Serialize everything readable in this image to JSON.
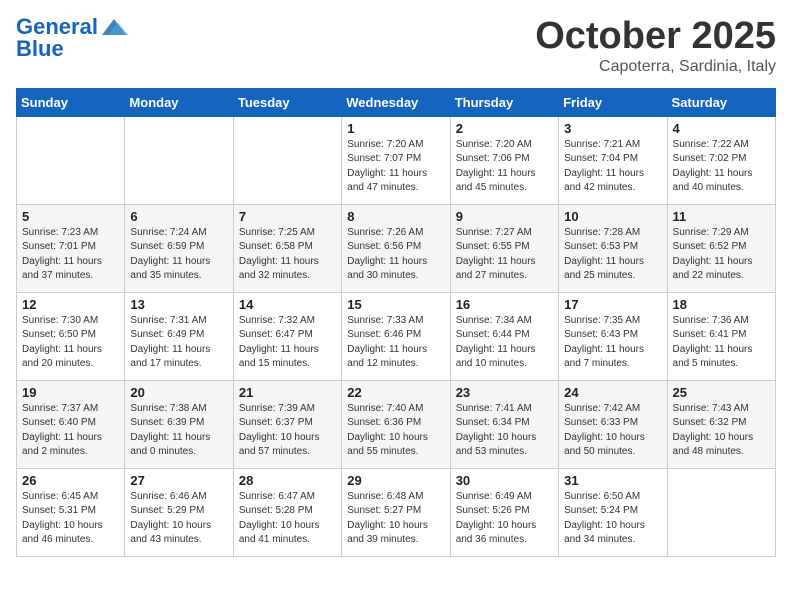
{
  "header": {
    "logo_general": "General",
    "logo_blue": "Blue",
    "month": "October 2025",
    "location": "Capoterra, Sardinia, Italy"
  },
  "days_of_week": [
    "Sunday",
    "Monday",
    "Tuesday",
    "Wednesday",
    "Thursday",
    "Friday",
    "Saturday"
  ],
  "weeks": [
    [
      {
        "day": "",
        "info": ""
      },
      {
        "day": "",
        "info": ""
      },
      {
        "day": "",
        "info": ""
      },
      {
        "day": "1",
        "info": "Sunrise: 7:20 AM\nSunset: 7:07 PM\nDaylight: 11 hours and 47 minutes."
      },
      {
        "day": "2",
        "info": "Sunrise: 7:20 AM\nSunset: 7:06 PM\nDaylight: 11 hours and 45 minutes."
      },
      {
        "day": "3",
        "info": "Sunrise: 7:21 AM\nSunset: 7:04 PM\nDaylight: 11 hours and 42 minutes."
      },
      {
        "day": "4",
        "info": "Sunrise: 7:22 AM\nSunset: 7:02 PM\nDaylight: 11 hours and 40 minutes."
      }
    ],
    [
      {
        "day": "5",
        "info": "Sunrise: 7:23 AM\nSunset: 7:01 PM\nDaylight: 11 hours and 37 minutes."
      },
      {
        "day": "6",
        "info": "Sunrise: 7:24 AM\nSunset: 6:59 PM\nDaylight: 11 hours and 35 minutes."
      },
      {
        "day": "7",
        "info": "Sunrise: 7:25 AM\nSunset: 6:58 PM\nDaylight: 11 hours and 32 minutes."
      },
      {
        "day": "8",
        "info": "Sunrise: 7:26 AM\nSunset: 6:56 PM\nDaylight: 11 hours and 30 minutes."
      },
      {
        "day": "9",
        "info": "Sunrise: 7:27 AM\nSunset: 6:55 PM\nDaylight: 11 hours and 27 minutes."
      },
      {
        "day": "10",
        "info": "Sunrise: 7:28 AM\nSunset: 6:53 PM\nDaylight: 11 hours and 25 minutes."
      },
      {
        "day": "11",
        "info": "Sunrise: 7:29 AM\nSunset: 6:52 PM\nDaylight: 11 hours and 22 minutes."
      }
    ],
    [
      {
        "day": "12",
        "info": "Sunrise: 7:30 AM\nSunset: 6:50 PM\nDaylight: 11 hours and 20 minutes."
      },
      {
        "day": "13",
        "info": "Sunrise: 7:31 AM\nSunset: 6:49 PM\nDaylight: 11 hours and 17 minutes."
      },
      {
        "day": "14",
        "info": "Sunrise: 7:32 AM\nSunset: 6:47 PM\nDaylight: 11 hours and 15 minutes."
      },
      {
        "day": "15",
        "info": "Sunrise: 7:33 AM\nSunset: 6:46 PM\nDaylight: 11 hours and 12 minutes."
      },
      {
        "day": "16",
        "info": "Sunrise: 7:34 AM\nSunset: 6:44 PM\nDaylight: 11 hours and 10 minutes."
      },
      {
        "day": "17",
        "info": "Sunrise: 7:35 AM\nSunset: 6:43 PM\nDaylight: 11 hours and 7 minutes."
      },
      {
        "day": "18",
        "info": "Sunrise: 7:36 AM\nSunset: 6:41 PM\nDaylight: 11 hours and 5 minutes."
      }
    ],
    [
      {
        "day": "19",
        "info": "Sunrise: 7:37 AM\nSunset: 6:40 PM\nDaylight: 11 hours and 2 minutes."
      },
      {
        "day": "20",
        "info": "Sunrise: 7:38 AM\nSunset: 6:39 PM\nDaylight: 11 hours and 0 minutes."
      },
      {
        "day": "21",
        "info": "Sunrise: 7:39 AM\nSunset: 6:37 PM\nDaylight: 10 hours and 57 minutes."
      },
      {
        "day": "22",
        "info": "Sunrise: 7:40 AM\nSunset: 6:36 PM\nDaylight: 10 hours and 55 minutes."
      },
      {
        "day": "23",
        "info": "Sunrise: 7:41 AM\nSunset: 6:34 PM\nDaylight: 10 hours and 53 minutes."
      },
      {
        "day": "24",
        "info": "Sunrise: 7:42 AM\nSunset: 6:33 PM\nDaylight: 10 hours and 50 minutes."
      },
      {
        "day": "25",
        "info": "Sunrise: 7:43 AM\nSunset: 6:32 PM\nDaylight: 10 hours and 48 minutes."
      }
    ],
    [
      {
        "day": "26",
        "info": "Sunrise: 6:45 AM\nSunset: 5:31 PM\nDaylight: 10 hours and 46 minutes."
      },
      {
        "day": "27",
        "info": "Sunrise: 6:46 AM\nSunset: 5:29 PM\nDaylight: 10 hours and 43 minutes."
      },
      {
        "day": "28",
        "info": "Sunrise: 6:47 AM\nSunset: 5:28 PM\nDaylight: 10 hours and 41 minutes."
      },
      {
        "day": "29",
        "info": "Sunrise: 6:48 AM\nSunset: 5:27 PM\nDaylight: 10 hours and 39 minutes."
      },
      {
        "day": "30",
        "info": "Sunrise: 6:49 AM\nSunset: 5:26 PM\nDaylight: 10 hours and 36 minutes."
      },
      {
        "day": "31",
        "info": "Sunrise: 6:50 AM\nSunset: 5:24 PM\nDaylight: 10 hours and 34 minutes."
      },
      {
        "day": "",
        "info": ""
      }
    ]
  ]
}
